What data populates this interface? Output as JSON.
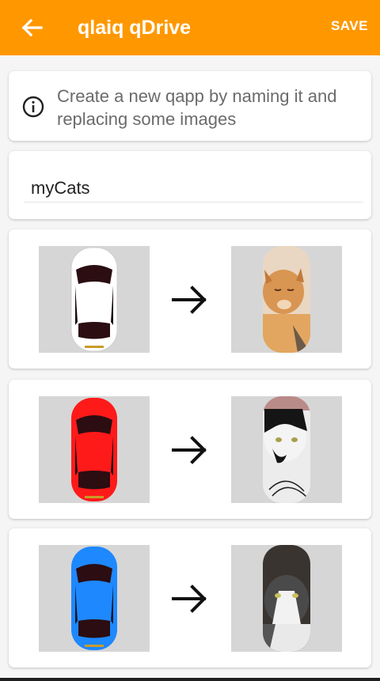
{
  "appbar": {
    "title": "qlaiq qDrive",
    "save_label": "SAVE",
    "back_icon": "arrow-back-icon",
    "color": "#ff9800"
  },
  "info": {
    "icon": "info-icon",
    "text": "Create a new qapp by naming it and replacing some images"
  },
  "name_field": {
    "value": "myCats"
  },
  "replacements": [
    {
      "source": "white-car-image",
      "car_color": "#ffffff",
      "target": "orange-cat-image",
      "arrow": "arrow-right-icon"
    },
    {
      "source": "red-car-image",
      "car_color": "#ff1a1a",
      "target": "black-white-cat-image",
      "arrow": "arrow-right-icon"
    },
    {
      "source": "blue-car-image",
      "car_color": "#1e88ff",
      "target": "grey-white-cat-image",
      "arrow": "arrow-right-icon"
    }
  ]
}
